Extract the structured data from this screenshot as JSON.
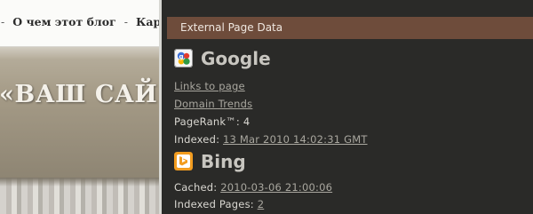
{
  "site": {
    "nav_items": [
      "О чем этот блог",
      "Кар"
    ],
    "nav_separator": "-",
    "title": "«ВАШ САЙ"
  },
  "panel": {
    "header": "External Page Data",
    "google": {
      "name": "Google",
      "icon": "google-icon",
      "links_to_page": "Links to page",
      "domain_trends": "Domain Trends",
      "pagerank_label": "PageRank™:",
      "pagerank_value": "4",
      "indexed_label": "Indexed:",
      "indexed_value": "13 Mar 2010 14:02:31 GMT"
    },
    "bing": {
      "name": "Bing",
      "icon": "bing-icon",
      "cached_label": "Cached:",
      "cached_value": "2010-03-06 21:00:06",
      "indexed_pages_label": "Indexed Pages:",
      "indexed_pages_value": "2"
    }
  },
  "colors": {
    "panel_bg": "#2a2a28",
    "header_bg": "#6e4c3b",
    "link": "#a9a79f",
    "text": "#cfcdc7",
    "bing_orange": "#f29c1f"
  }
}
